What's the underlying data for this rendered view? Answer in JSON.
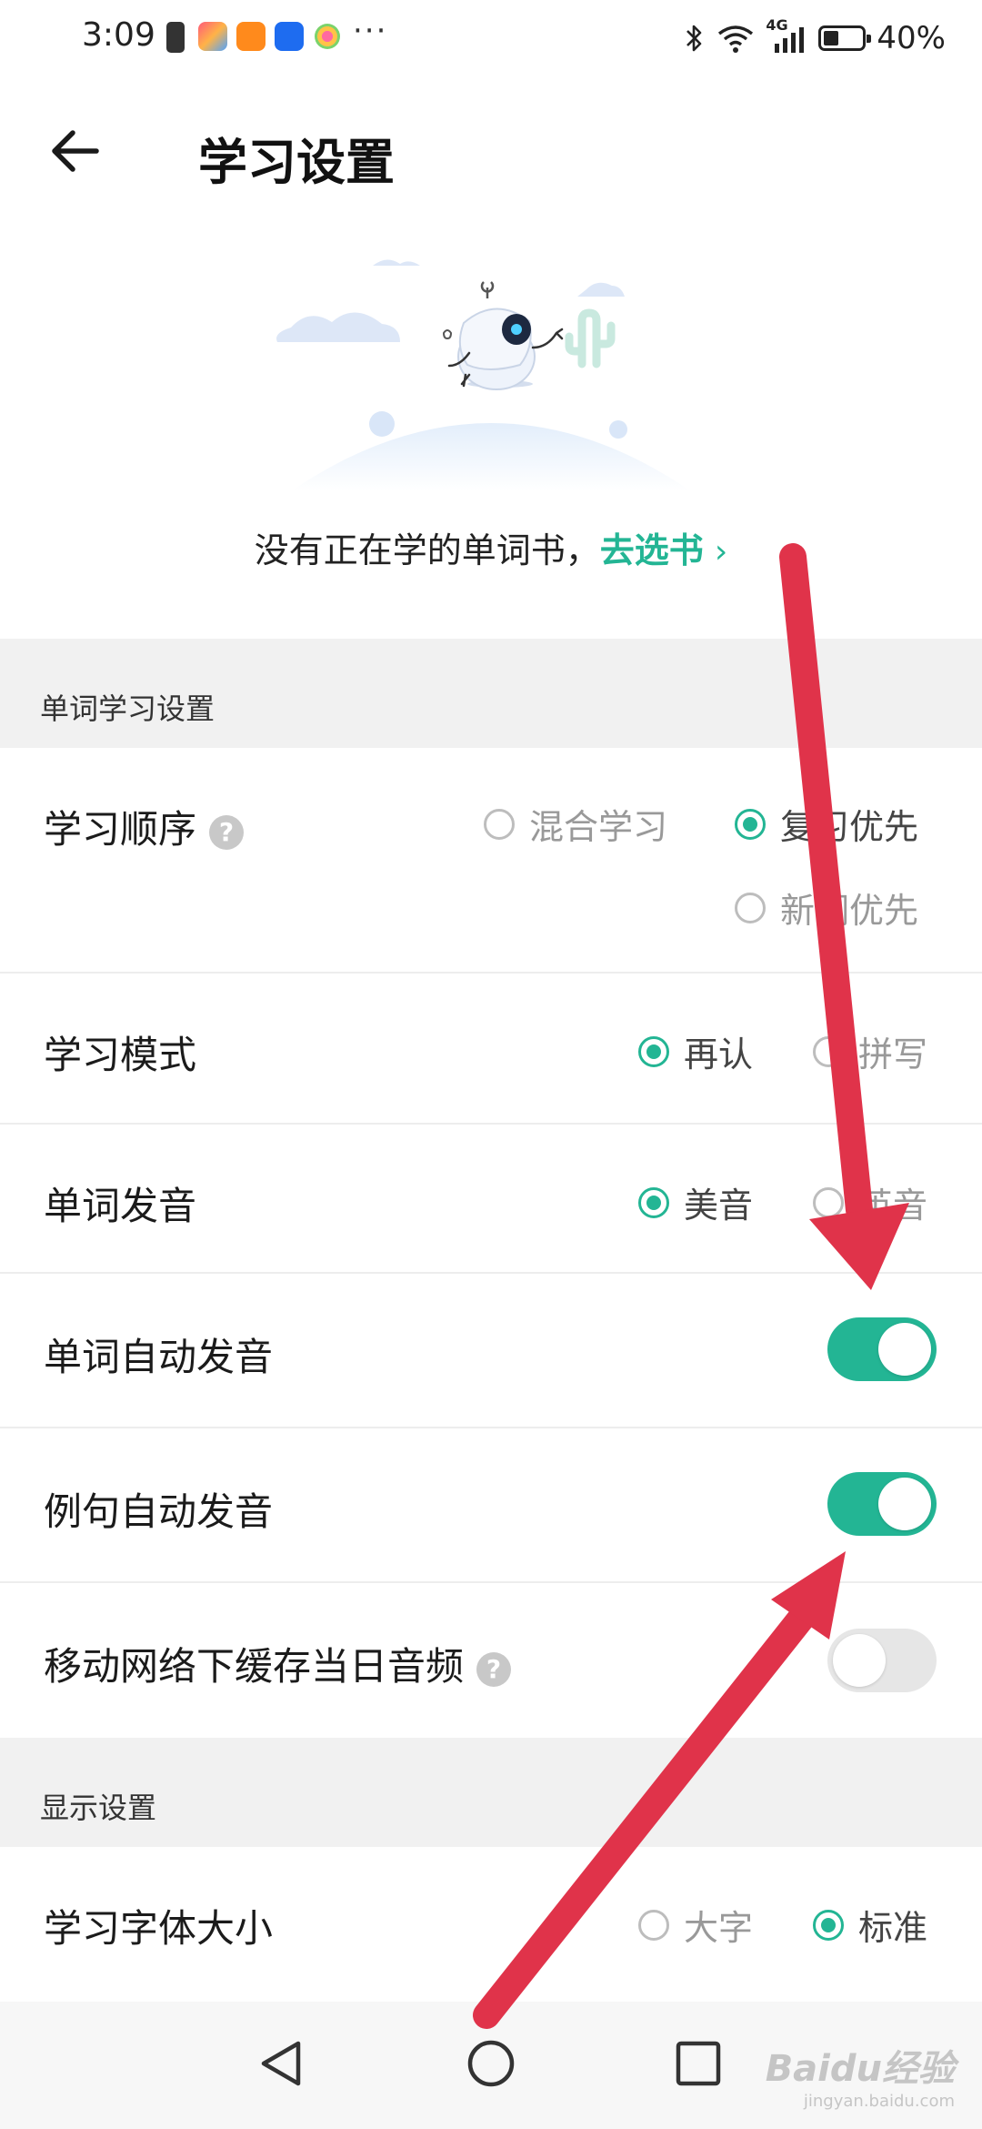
{
  "status_bar": {
    "time": "3:09",
    "dots": "···",
    "network": "4G",
    "battery_percent": "40%",
    "battery_level": 0.4
  },
  "header": {
    "title": "学习设置"
  },
  "empty_state": {
    "message": "没有正在学的单词书，",
    "link_label": "去选书",
    "chevron": "›"
  },
  "sections": {
    "word_settings": {
      "title": "单词学习设置"
    },
    "display_settings": {
      "title": "显示设置"
    }
  },
  "rows": {
    "order": {
      "label": "学习顺序",
      "help": "?",
      "options": [
        {
          "label": "混合学习",
          "selected": false
        },
        {
          "label": "复习优先",
          "selected": true
        },
        {
          "label": "新词优先",
          "selected": false
        }
      ]
    },
    "mode": {
      "label": "学习模式",
      "options": [
        {
          "label": "再认",
          "selected": true
        },
        {
          "label": "拼写",
          "selected": false
        }
      ]
    },
    "pronunciation": {
      "label": "单词发音",
      "options": [
        {
          "label": "美音",
          "selected": true
        },
        {
          "label": "英音",
          "selected": false
        }
      ]
    },
    "auto_word": {
      "label": "单词自动发音",
      "enabled": true
    },
    "auto_sentence": {
      "label": "例句自动发音",
      "enabled": true
    },
    "cache_audio": {
      "label": "移动网络下缓存当日音频",
      "help": "?",
      "enabled": false
    },
    "font_size": {
      "label": "学习字体大小",
      "options": [
        {
          "label": "大字",
          "selected": false
        },
        {
          "label": "标准",
          "selected": true
        }
      ]
    }
  },
  "watermark": {
    "brand": "Baidu经验",
    "url": "jingyan.baidu.com"
  },
  "colors": {
    "accent": "#23b594",
    "annotation_arrow": "#e0334a",
    "section_bg": "#f1f1f1",
    "toggle_off": "#e6e6e6"
  },
  "icons": {
    "back": "arrow-left-icon",
    "nav_back": "triangle-back-icon",
    "nav_home": "circle-home-icon",
    "nav_recents": "square-recents-icon"
  }
}
